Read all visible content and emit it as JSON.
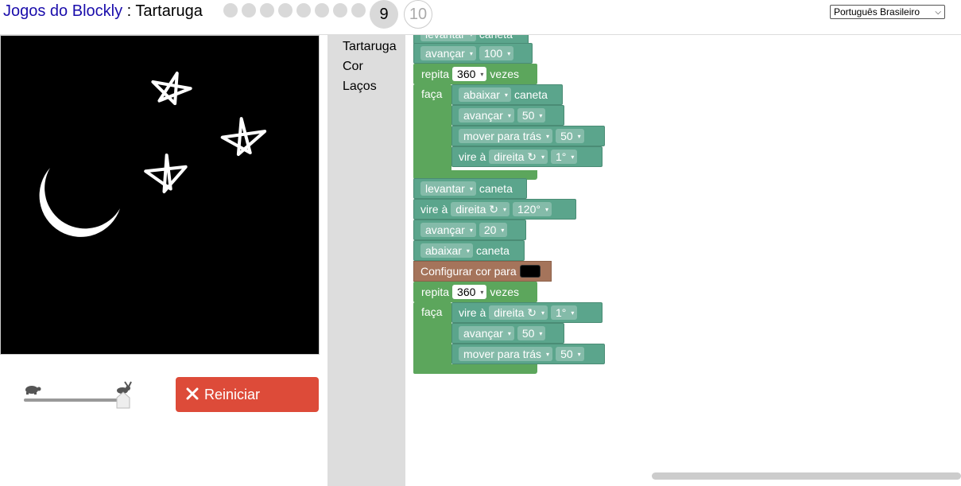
{
  "header": {
    "app_name": "Jogos do Blockly",
    "separator": " : ",
    "game_name": "Tartaruga",
    "current_level": "9",
    "next_level": "10",
    "language": "Português Brasileiro"
  },
  "controls": {
    "reset_label": "Reiniciar",
    "speed": 1.0
  },
  "toolbox": {
    "categories": [
      "Tartaruga",
      "Cor",
      "Laços"
    ]
  },
  "blocks": {
    "top_partial": {
      "verb": "levantar",
      "obj": "caneta"
    },
    "b1": {
      "verb": "avançar",
      "value": "100"
    },
    "loop1": {
      "repeat": "repita",
      "count": "360",
      "times": "vezes",
      "do": "faça"
    },
    "l1a": {
      "verb": "abaixar",
      "obj": "caneta"
    },
    "l1b": {
      "verb": "avançar",
      "value": "50"
    },
    "l1c": {
      "verb": "mover para trás",
      "value": "50"
    },
    "l1d": {
      "verb": "vire à",
      "dir": "direita ↻",
      "value": "1°"
    },
    "b2": {
      "verb": "levantar",
      "obj": "caneta"
    },
    "b3": {
      "verb": "vire à",
      "dir": "direita ↻",
      "value": "120°"
    },
    "b4": {
      "verb": "avançar",
      "value": "20"
    },
    "b5": {
      "verb": "abaixar",
      "obj": "caneta"
    },
    "b6": {
      "label": "Configurar cor para",
      "color": "#000000"
    },
    "loop2": {
      "repeat": "repita",
      "count": "360",
      "times": "vezes",
      "do": "faça"
    },
    "l2a": {
      "verb": "vire à",
      "dir": "direita ↻",
      "value": "1°"
    },
    "l2b": {
      "verb": "avançar",
      "value": "50"
    },
    "l2c": {
      "verb": "mover para trás",
      "value": "50"
    }
  },
  "colors": {
    "turtle_block": "#5ba58c",
    "loop_block": "#5ca65c",
    "colour_block": "#a5745b",
    "reset_button": "#dd4b39"
  }
}
